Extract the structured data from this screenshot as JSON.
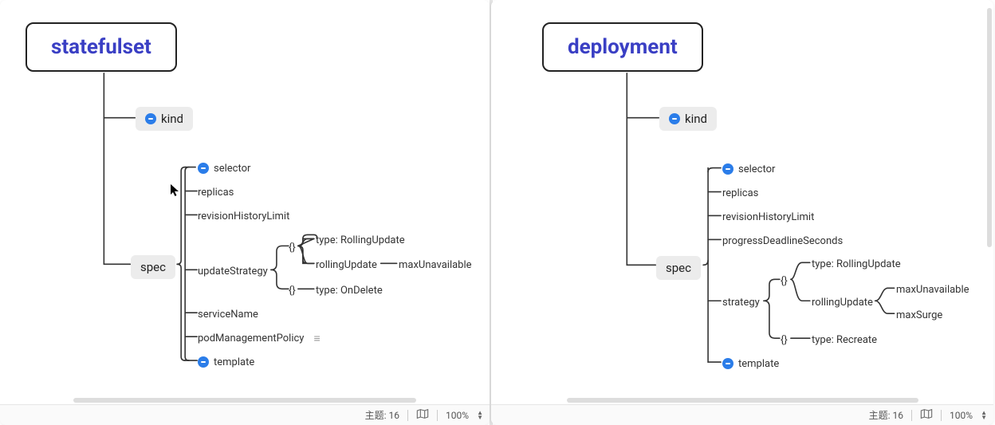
{
  "left": {
    "root": "statefulset",
    "kind": "kind",
    "spec": "spec",
    "selector": "selector",
    "replicas": "replicas",
    "revisionHistoryLimit": "revisionHistoryLimit",
    "updateStrategy": "updateStrategy",
    "us_bracket1": "{}",
    "us_bracket2": "{}",
    "us_typeRolling": "type: RollingUpdate",
    "us_rollingUpdate": "rollingUpdate",
    "us_maxUnavailable": "maxUnavailable",
    "us_typeOnDelete": "type: OnDelete",
    "serviceName": "serviceName",
    "podManagementPolicy": "podManagementPolicy",
    "template": "template",
    "status": {
      "themeLabel": "主题:",
      "themeCount": "16",
      "zoom": "100%"
    }
  },
  "right": {
    "root": "deployment",
    "kind": "kind",
    "spec": "spec",
    "selector": "selector",
    "replicas": "replicas",
    "revisionHistoryLimit": "revisionHistoryLimit",
    "progressDeadlineSeconds": "progressDeadlineSeconds",
    "strategy": "strategy",
    "st_bracket1": "{}",
    "st_bracket2": "{}",
    "st_typeRolling": "type: RollingUpdate",
    "st_rollingUpdate": "rollingUpdate",
    "st_maxUnavailable": "maxUnavailable",
    "st_maxSurge": "maxSurge",
    "st_typeRecreate": "type: Recreate",
    "template": "template",
    "status": {
      "themeLabel": "主题:",
      "themeCount": "16",
      "zoom": "100%"
    }
  },
  "chart_data": [
    {
      "type": "tree",
      "title": "statefulset",
      "root": "statefulset",
      "children": [
        {
          "name": "kind"
        },
        {
          "name": "spec",
          "children": [
            {
              "name": "selector"
            },
            {
              "name": "replicas"
            },
            {
              "name": "revisionHistoryLimit"
            },
            {
              "name": "updateStrategy",
              "children": [
                {
                  "name": "{}",
                  "children": [
                    {
                      "name": "type: RollingUpdate"
                    },
                    {
                      "name": "rollingUpdate",
                      "children": [
                        {
                          "name": "maxUnavailable"
                        }
                      ]
                    }
                  ]
                },
                {
                  "name": "{}",
                  "children": [
                    {
                      "name": "type: OnDelete"
                    }
                  ]
                }
              ]
            },
            {
              "name": "serviceName"
            },
            {
              "name": "podManagementPolicy"
            },
            {
              "name": "template"
            }
          ]
        }
      ]
    },
    {
      "type": "tree",
      "title": "deployment",
      "root": "deployment",
      "children": [
        {
          "name": "kind"
        },
        {
          "name": "spec",
          "children": [
            {
              "name": "selector"
            },
            {
              "name": "replicas"
            },
            {
              "name": "revisionHistoryLimit"
            },
            {
              "name": "progressDeadlineSeconds"
            },
            {
              "name": "strategy",
              "children": [
                {
                  "name": "{}",
                  "children": [
                    {
                      "name": "type: RollingUpdate"
                    },
                    {
                      "name": "rollingUpdate",
                      "children": [
                        {
                          "name": "maxUnavailable"
                        },
                        {
                          "name": "maxSurge"
                        }
                      ]
                    }
                  ]
                },
                {
                  "name": "{}",
                  "children": [
                    {
                      "name": "type: Recreate"
                    }
                  ]
                }
              ]
            },
            {
              "name": "template"
            }
          ]
        }
      ]
    }
  ]
}
